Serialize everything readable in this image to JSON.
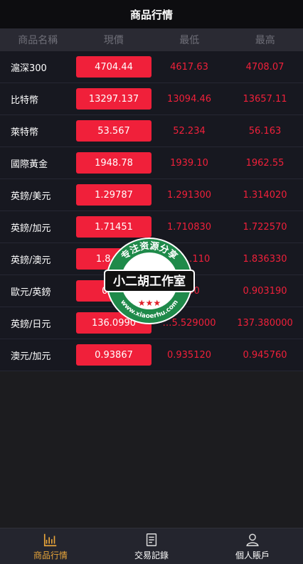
{
  "header": {
    "title": "商品行情"
  },
  "columns": {
    "name": "商品名稱",
    "now": "現價",
    "low": "最低",
    "high": "最高"
  },
  "rows": [
    {
      "name": "滬深300",
      "now": "4704.44",
      "low": "4617.63",
      "high": "4708.07"
    },
    {
      "name": "比特幣",
      "now": "13297.137",
      "low": "13094.46",
      "high": "13657.11"
    },
    {
      "name": "萊特幣",
      "now": "53.567",
      "low": "52.234",
      "high": "56.163"
    },
    {
      "name": "國際黃金",
      "now": "1948.78",
      "low": "1939.10",
      "high": "1962.55"
    },
    {
      "name": "英鎊/美元",
      "now": "1.29787",
      "low": "1.291300",
      "high": "1.314020"
    },
    {
      "name": "英鎊/加元",
      "now": "1.71451",
      "low": "1.710830",
      "high": "1.722570"
    },
    {
      "name": "英鎊/澳元",
      "now": "1.8…28",
      "low": "1.8…110",
      "high": "1.836330"
    },
    {
      "name": "歐元/英鎊",
      "now": "0.9…",
      "low": "…90",
      "high": "0.903190"
    },
    {
      "name": "英鎊/日元",
      "now": "136.0990",
      "low": "…5.529000",
      "high": "137.380000"
    },
    {
      "name": "澳元/加元",
      "now": "0.93867",
      "low": "0.935120",
      "high": "0.945760"
    }
  ],
  "watermark": {
    "arc_text": "专注资源分享",
    "banner": "小二胡工作室",
    "url": "www.xiaoerhu.com"
  },
  "tabs": [
    {
      "label": "商品行情",
      "icon": "chart-icon",
      "active": true
    },
    {
      "label": "交易記錄",
      "icon": "document-icon",
      "active": false
    },
    {
      "label": "個人賬戶",
      "icon": "user-icon",
      "active": false
    }
  ],
  "colors": {
    "accent": "#f0203a",
    "active_tab": "#e8a53a",
    "background": "#1c1c1f"
  }
}
